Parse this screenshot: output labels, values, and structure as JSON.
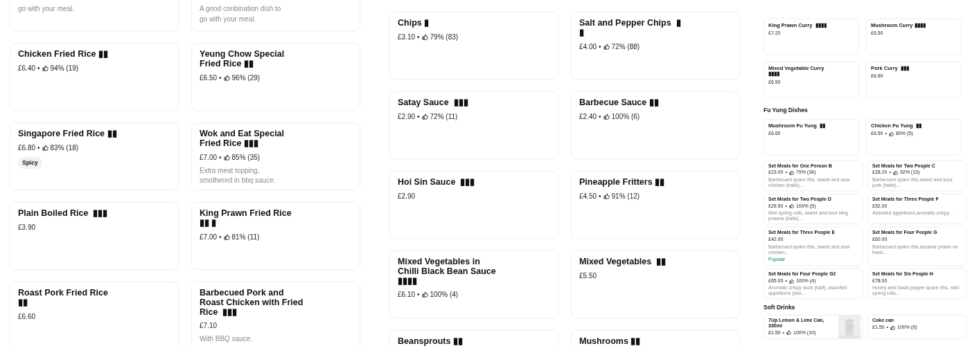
{
  "separator": "•",
  "panels": [
    {
      "sections": [
        {
          "items": [
            {
              "description": "go with your meal."
            },
            {
              "description": "A good conbination dish to go with your meal."
            },
            {
              "title": "Chicken Fried Rice ▮▮",
              "price": "£6.40",
              "rating": "94% (19)"
            },
            {
              "title": "Yeung Chow Special Fried Rice ▮▮",
              "price": "£6.50",
              "rating": "96% (29)"
            },
            {
              "title": "Singapore Fried Rice ▮▮",
              "price": "£6.80",
              "rating": "83% (18)",
              "tag": {
                "text": "Spicy",
                "kind": "pill"
              }
            },
            {
              "title": "Wok and Eat Special Fried Rice ▮▮▮",
              "price": "£7.00",
              "rating": "85% (35)",
              "description": "Extra meat topping, smothered in bbq sauce."
            },
            {
              "title": "Plain Boiled Rice  ▮▮▮",
              "price": "£3.90"
            },
            {
              "title": "King Prawn Fried Rice ▮▮ ▮",
              "price": "£7.00",
              "rating": "81% (11)"
            },
            {
              "title": "Roast Pork Fried Rice  ▮▮",
              "price": "£6.60"
            },
            {
              "title": "Barbecued Pork and Roast Chicken with Fried Rice  ▮▮▮",
              "price": "£7.10",
              "description": "With BBQ sauce."
            }
          ]
        }
      ]
    },
    {
      "sections": [
        {
          "items": [
            {
              "title": "Chips ▮",
              "price": "£3.10",
              "rating": "79% (83)"
            },
            {
              "title": "Salt and Pepper Chips  ▮ ▮",
              "price": "£4.00",
              "rating": "72% (88)"
            },
            {
              "title": "Satay Sauce  ▮▮▮",
              "price": "£2.90",
              "rating": "72% (11)"
            },
            {
              "title": "Barbecue Sauce ▮▮",
              "price": "£2.40",
              "rating": "100% (6)"
            },
            {
              "title": "Hoi Sin Sauce  ▮▮▮",
              "price": "£2.90"
            },
            {
              "title": "Pineapple Fritters ▮▮",
              "price": "£4.50",
              "rating": "91% (12)"
            },
            {
              "title": "Mixed Vegetables in Chilli Black Bean Sauce ▮▮▮▮",
              "price": "£6.10",
              "rating": "100% (4)"
            },
            {
              "title": "Mixed Vegetables  ▮▮",
              "price": "£5.50"
            },
            {
              "title": "Beansprouts ▮▮"
            },
            {
              "title": "Mushrooms ▮▮"
            }
          ]
        }
      ]
    },
    {
      "sections": [
        {
          "items": [
            {
              "title": "King Prawn Curry  ▮▮▮▮",
              "price": "£7.20"
            },
            {
              "title": "Mushroom Curry ▮▮▮▮",
              "price": "£6.50"
            },
            {
              "title": "Mixed Vegetable Curry ▮▮▮▮",
              "price": "£6.50"
            },
            {
              "title": "Pork Curry  ▮▮▮",
              "price": "£6.60"
            }
          ]
        },
        {
          "heading": "Fu Yung Dishes",
          "items": [
            {
              "title": "Mushroom Fu Yung  ▮▮",
              "price": "£6.60"
            },
            {
              "title": "Chicken Fu Yung  ▮▮",
              "price": "£6.50",
              "rating": "80% (5)"
            }
          ]
        }
      ],
      "overlay": {
        "sections": [
          {
            "items": [
              {
                "title": "Set Meals for One Person B",
                "price": "£23.00",
                "rating": "79% (34)",
                "description": "Barbecued spare ribs, sweet and sour chicken (balls)..."
              },
              {
                "title": "Set Meals for Two People C",
                "price": "£28.20",
                "rating": "92% (13)",
                "description": "Barbecued spare ribs,sweet and sour pork (balls)..."
              },
              {
                "title": "Set Meals for Two People D",
                "price": "£29.50",
                "rating": "100% (5)",
                "description": "Mini spring rolls, sweet and sour king prawns (balls)..."
              },
              {
                "title": "Set Meals for Three People F",
                "price": "£52.00",
                "description": "Assorted appetisers,aromatic crispy..."
              },
              {
                "title": "Set Meals for Three People E",
                "price": "£42.00",
                "description": "Barbecued spare ribs, sweet and sour chicken...",
                "tag": {
                  "text": "Popular",
                  "kind": "label"
                }
              },
              {
                "title": "Set Meals for Four People G",
                "price": "£60.00",
                "description": "Barbecued spare ribs,sesame prawn on toast..."
              },
              {
                "title": "Set Meals for Four People G2",
                "price": "£65.00",
                "rating": "100% (4)",
                "description": "Aromatic crispy duck (half), assorted appetisers (see..."
              },
              {
                "title": "Set Meals for Six People H",
                "price": "£78.00",
                "description": "Honey and black pepper spare ribs, mini spring rolls,..."
              }
            ]
          },
          {
            "heading": "Soft Drinks",
            "items": [
              {
                "title": "7Up Lemon & Lime Can, 330ml",
                "price": "£1.50",
                "rating": "100% (10)",
                "image": true
              },
              {
                "title": "Coke can",
                "price": "£1.50",
                "rating": "100% (6)"
              }
            ]
          }
        ]
      }
    }
  ]
}
